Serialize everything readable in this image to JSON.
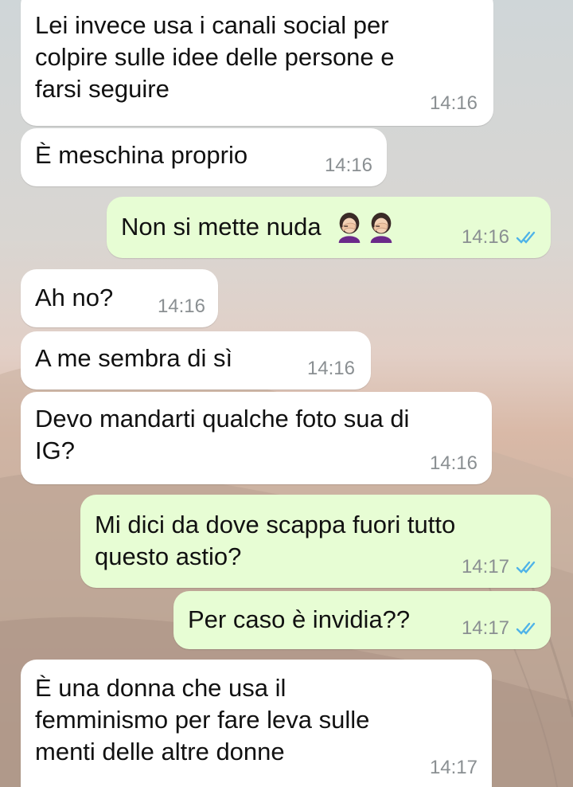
{
  "messages": [
    {
      "direction": "in",
      "text": "Lei invece usa i canali social per\ncolpire sulle idee delle persone e\nfarsi seguire",
      "time": "14:16"
    },
    {
      "direction": "in",
      "text": "È meschina proprio",
      "time": "14:16"
    },
    {
      "direction": "out",
      "text": "Non si mette nuda",
      "emoji": [
        "facepalm-woman",
        "facepalm-woman"
      ],
      "time": "14:16",
      "status": "read"
    },
    {
      "direction": "in",
      "text": "Ah no?",
      "time": "14:16"
    },
    {
      "direction": "in",
      "text": "A me sembra di sì",
      "time": "14:16"
    },
    {
      "direction": "in",
      "text": "Devo mandarti qualche foto sua di\nIG?",
      "time": "14:16"
    },
    {
      "direction": "out",
      "text": "Mi dici da dove scappa fuori tutto\nquesto astio?",
      "time": "14:17",
      "status": "read"
    },
    {
      "direction": "out",
      "text": "Per caso è invidia??",
      "time": "14:17",
      "status": "read"
    },
    {
      "direction": "in",
      "text": "È una donna che usa il\nfemminismo per fare leva sulle\nmenti delle altre donne",
      "time": "14:17"
    }
  ],
  "colors": {
    "incoming_bubble": "#ffffff",
    "outgoing_bubble": "#e7fdd4",
    "timestamp": "#8a8f92",
    "read_ticks": "#4fb3e8"
  }
}
